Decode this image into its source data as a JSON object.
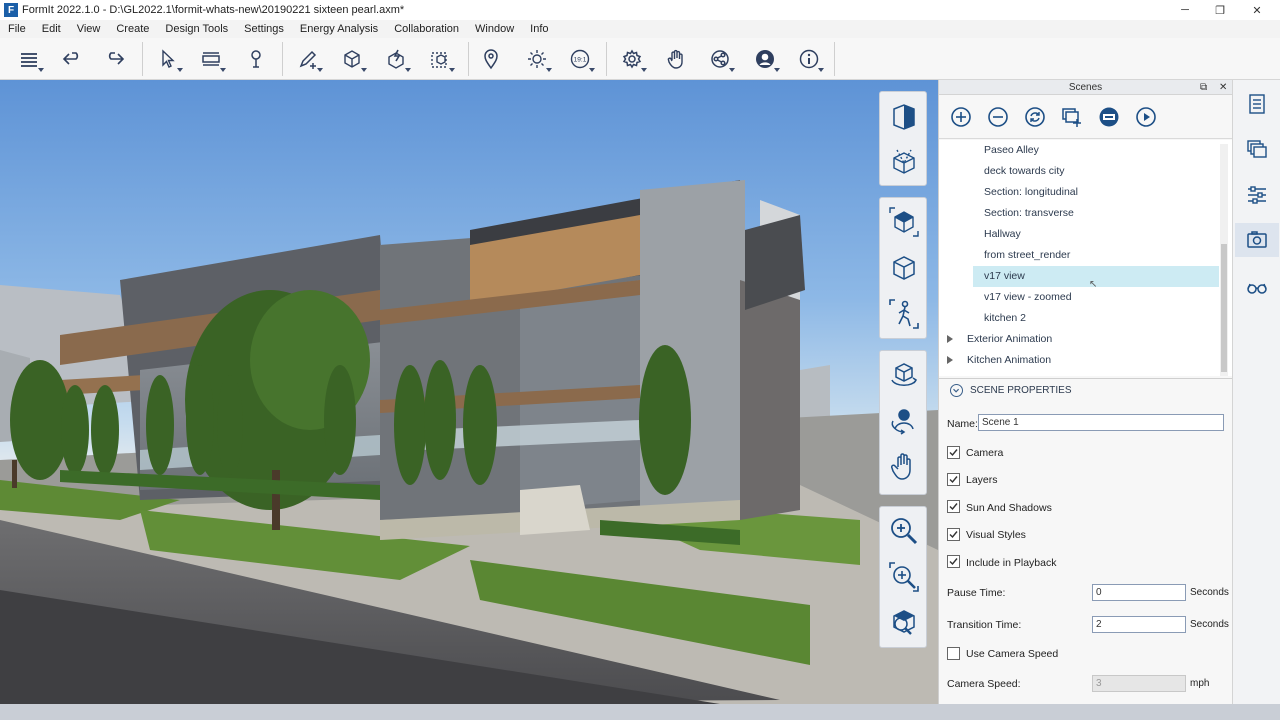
{
  "window": {
    "title": "FormIt 2022.1.0 - D:\\GL2022.1\\formit-whats-new\\20190221 sixteen pearl.axm*",
    "app_glyph": "F",
    "controls": {
      "minimize": "─",
      "restore": "❐",
      "close": "✕"
    }
  },
  "menu": [
    "File",
    "Edit",
    "View",
    "Create",
    "Design Tools",
    "Settings",
    "Energy Analysis",
    "Collaboration",
    "Window",
    "Info"
  ],
  "toolbar": {
    "icons": [
      "layers-stack-icon",
      "undo-icon",
      "redo-icon",
      "select-icon",
      "level-icon",
      "paint-icon",
      "pencil-draw-icon",
      "cube-create-icon",
      "generate-icon",
      "group-icon",
      "location-pin-icon",
      "sun-icon",
      "solar-time-icon",
      "settings-gear-icon",
      "hand-pan-icon",
      "share-icon",
      "user-account-icon",
      "info-icon"
    ],
    "sun_badge": "19:1"
  },
  "scenes_panel": {
    "title": "Scenes",
    "title_controls": {
      "float": "⧉",
      "close": "✕"
    },
    "tools": [
      "add-scene-icon",
      "remove-scene-icon",
      "update-scene-icon",
      "add-scene-group-icon",
      "edit-scene-icon",
      "play-animation-icon"
    ],
    "list": [
      {
        "label": "Paseo Alley",
        "kind": "scene"
      },
      {
        "label": "deck towards city",
        "kind": "scene"
      },
      {
        "label": "Section: longitudinal",
        "kind": "scene"
      },
      {
        "label": "Section: transverse",
        "kind": "scene"
      },
      {
        "label": "Hallway",
        "kind": "scene"
      },
      {
        "label": "from street_render",
        "kind": "scene"
      },
      {
        "label": "v17 view",
        "kind": "scene",
        "selected": true
      },
      {
        "label": "v17 view - zoomed",
        "kind": "scene"
      },
      {
        "label": "kitchen 2",
        "kind": "scene"
      },
      {
        "label": "Exterior Animation",
        "kind": "group"
      },
      {
        "label": "Kitchen Animation",
        "kind": "group"
      }
    ],
    "properties": {
      "header": "SCENE PROPERTIES",
      "name_label": "Name:",
      "name_value": "Scene 1",
      "checks": [
        {
          "label": "Camera",
          "checked": true
        },
        {
          "label": "Layers",
          "checked": true
        },
        {
          "label": "Sun And Shadows",
          "checked": true
        },
        {
          "label": "Visual Styles",
          "checked": true
        },
        {
          "label": "Include in Playback",
          "checked": true
        }
      ],
      "pause_time": {
        "label": "Pause Time:",
        "value": "0",
        "unit": "Seconds"
      },
      "transition_time": {
        "label": "Transition Time:",
        "value": "2",
        "unit": "Seconds"
      },
      "use_camera_speed": {
        "label": "Use Camera Speed",
        "checked": false
      },
      "camera_speed": {
        "label": "Camera Speed:",
        "value": "3",
        "unit": "mph"
      }
    }
  },
  "nav_tools": [
    "view-cube-icon",
    "orbit-section-icon",
    "home-view-icon",
    "perspective-cube-icon",
    "walk-through-icon",
    "orbit-icon",
    "look-around-icon",
    "pan-hand-icon",
    "zoom-icon",
    "zoom-window-icon",
    "zoom-extents-icon"
  ],
  "right_bar": [
    "properties-panel-icon",
    "layers-panel-icon",
    "levels-panel-icon",
    "scenes-panel-icon",
    "visual-styles-icon"
  ],
  "colors": {
    "accent": "#1b5fa8",
    "selection": "#cdebf3",
    "sky": "#5e93d6",
    "grass": "#5e8a35"
  }
}
